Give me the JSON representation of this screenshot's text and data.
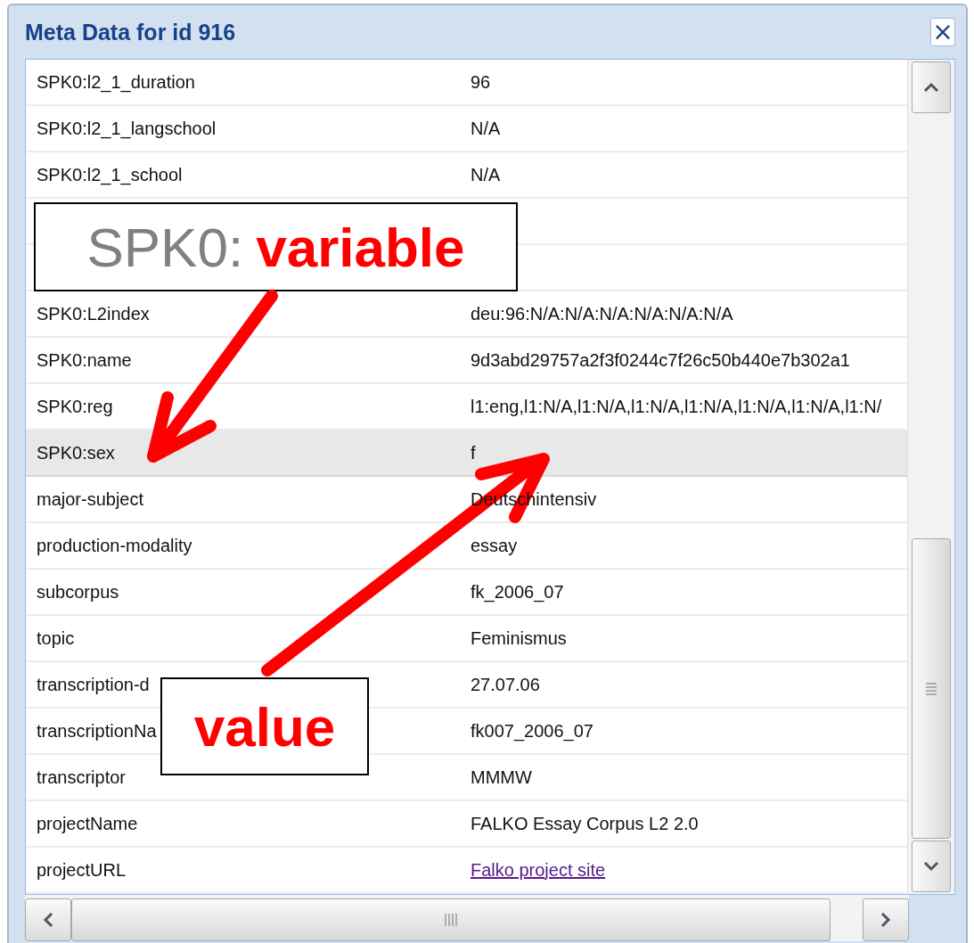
{
  "window": {
    "title": "Meta Data for id 916",
    "close": "×"
  },
  "rows": [
    {
      "key": "SPK0:l2_1_duration",
      "value": "96",
      "kind": "text",
      "selected": false
    },
    {
      "key": "SPK0:l2_1_langschool",
      "value": "N/A",
      "kind": "text",
      "selected": false
    },
    {
      "key": "SPK0:l2_1_school",
      "value": "N/A",
      "kind": "text",
      "selected": false
    },
    {
      "kind": "blank"
    },
    {
      "kind": "blank"
    },
    {
      "key": "SPK0:L2index",
      "value": "deu:96:N/A:N/A:N/A:N/A:N/A:N/A",
      "kind": "text",
      "selected": false
    },
    {
      "key": "SPK0:name",
      "value": "9d3abd29757a2f3f0244c7f26c50b440e7b302a1",
      "kind": "text",
      "selected": false
    },
    {
      "key": "SPK0:reg",
      "value": "l1:eng,l1:N/A,l1:N/A,l1:N/A,l1:N/A,l1:N/A,l1:N/A,l1:N/",
      "kind": "text",
      "selected": false
    },
    {
      "key": "SPK0:sex",
      "value": "f",
      "kind": "text",
      "selected": true
    },
    {
      "key": "major-subject",
      "value": "Deutschintensiv",
      "kind": "text",
      "selected": false
    },
    {
      "key": "production-modality",
      "value": "essay",
      "kind": "text",
      "selected": false
    },
    {
      "key": "subcorpus",
      "value": "fk_2006_07",
      "kind": "text",
      "selected": false
    },
    {
      "key": "topic",
      "value": "Feminismus",
      "kind": "text",
      "selected": false
    },
    {
      "key": "transcription-d",
      "value": "27.07.06",
      "kind": "text",
      "selected": false
    },
    {
      "key": "transcriptionNa",
      "value": "fk007_2006_07",
      "kind": "text",
      "selected": false
    },
    {
      "key": "transcriptor",
      "value": "MMMW",
      "kind": "text",
      "selected": false
    },
    {
      "key": "projectName",
      "value": "FALKO Essay Corpus L2 2.0",
      "kind": "text",
      "selected": false
    },
    {
      "key": "projectURL",
      "value": "Falko project site",
      "kind": "link",
      "selected": false
    }
  ],
  "annotations": [
    {
      "prefix": "SPK0:",
      "term": "variable"
    },
    {
      "term": "value"
    }
  ]
}
